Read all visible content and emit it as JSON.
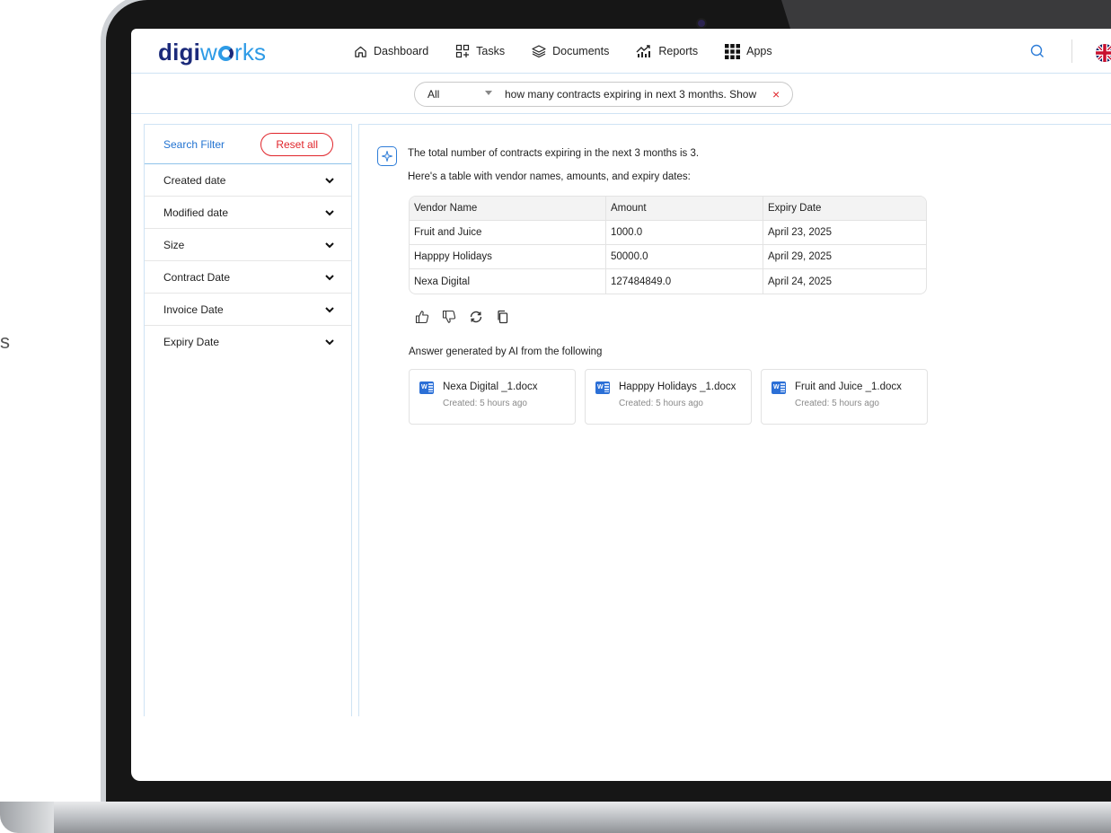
{
  "app": {
    "logo_dark": "digi",
    "logo_light_a": "w",
    "logo_light_b": "rks"
  },
  "nav": {
    "items": [
      {
        "label": "Dashboard",
        "icon": "home-icon"
      },
      {
        "label": "Tasks",
        "icon": "tasks-grid-icon"
      },
      {
        "label": "Documents",
        "icon": "layers-icon"
      },
      {
        "label": "Reports",
        "icon": "chart-up-icon"
      },
      {
        "label": "Apps",
        "icon": "apps-grid-icon"
      }
    ]
  },
  "search": {
    "scope": "All",
    "query": "how many contracts expiring in next 3 months. Show",
    "clear": "×"
  },
  "filter": {
    "title": "Search Filter",
    "reset_label": "Reset all",
    "facets": [
      "Created date",
      "Modified date",
      "Size",
      "Contract Date",
      "Invoice Date",
      "Expiry Date"
    ]
  },
  "answer": {
    "summary": "The total number of contracts expiring in the next 3 months is 3.",
    "intro": "Here's a table with vendor names, amounts, and expiry dates:",
    "table": {
      "headers": [
        "Vendor Name",
        "Amount",
        "Expiry Date"
      ],
      "rows": [
        [
          "Fruit and Juice",
          "1000.0",
          "April 23, 2025"
        ],
        [
          "Happpy Holidays",
          "50000.0",
          "April 29, 2025"
        ],
        [
          "Nexa Digital",
          "127484849.0",
          "April 24, 2025"
        ]
      ]
    },
    "sources_label": "Answer generated by AI from the following",
    "sources": [
      {
        "name": "Nexa Digital _1.docx",
        "meta": "Created: 5 hours ago"
      },
      {
        "name": "Happpy Holidays _1.docx",
        "meta": "Created: 5 hours ago"
      },
      {
        "name": "Fruit and Juice _1.docx",
        "meta": "Created: 5 hours ago"
      }
    ]
  },
  "side_text": "s",
  "colors": {
    "brand_dark": "#1b2a7a",
    "brand_light": "#2e9be6",
    "accent_red": "#e0252b",
    "link_blue": "#2273d1"
  }
}
